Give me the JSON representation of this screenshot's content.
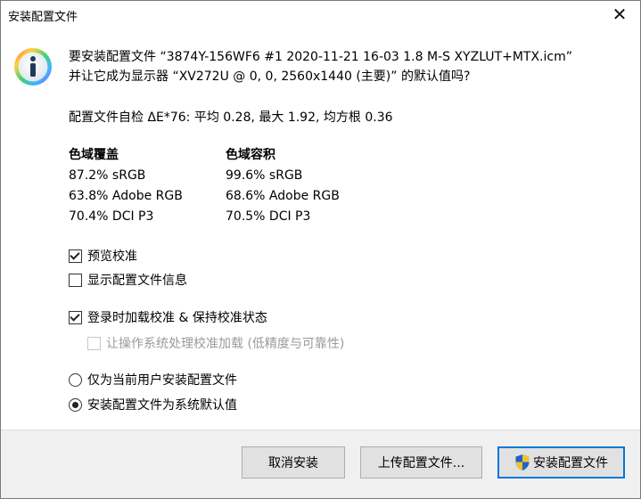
{
  "window": {
    "title": "安装配置文件",
    "close_glyph": "✕"
  },
  "message": {
    "line1": "要安装配置文件 “3874Y-156WF6 #1 2020-11-21 16-03 1.8 M-S XYZLUT+MTX.icm”",
    "line2": "并让它成为显示器 “XV272U @ 0, 0, 2560x1440 (主要)” 的默认值吗?"
  },
  "self_check": "配置文件自检 ΔE*76: 平均 0.28, 最大 1.92, 均方根 0.36",
  "gamut_coverage": {
    "header": "色域覆盖",
    "rows": [
      "87.2% sRGB",
      "63.8% Adobe RGB",
      "70.4% DCI P3"
    ]
  },
  "gamut_volume": {
    "header": "色域容积",
    "rows": [
      "99.6% sRGB",
      "68.6% Adobe RGB",
      "70.5% DCI P3"
    ]
  },
  "options": {
    "preview_calibration": {
      "label": "预览校准",
      "checked": true
    },
    "show_profile_info": {
      "label": "显示配置文件信息",
      "checked": false
    },
    "load_on_login": {
      "label": "登录时加载校准 & 保持校准状态",
      "checked": true
    },
    "os_handles_loading": {
      "label": "让操作系统处理校准加载 (低精度与可靠性)",
      "checked": false,
      "disabled": true
    }
  },
  "scope": {
    "current_user": {
      "label": "仅为当前用户安装配置文件",
      "selected": false
    },
    "system_default": {
      "label": "安装配置文件为系统默认值",
      "selected": true
    }
  },
  "buttons": {
    "cancel": "取消安装",
    "upload": "上传配置文件...",
    "install": "安装配置文件"
  },
  "icons": {
    "info": "info-icon",
    "shield": "uac-shield-icon",
    "close": "close-icon"
  }
}
